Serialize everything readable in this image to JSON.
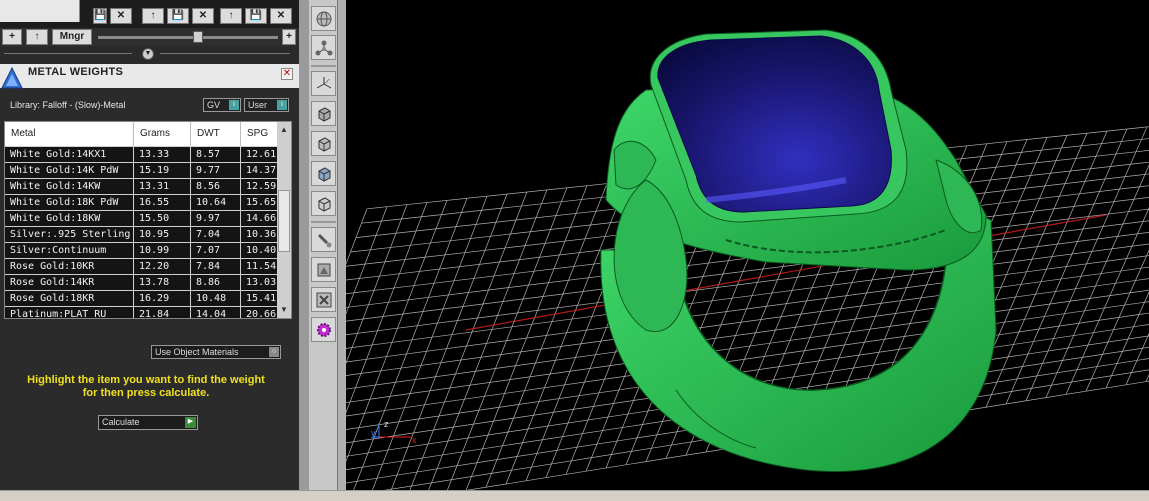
{
  "toolbar_top": {
    "mngr_label": "Mngr",
    "plus_label": "+",
    "up_label": "↑",
    "close_label": "✕",
    "save_label": "💾"
  },
  "panel": {
    "title": "METAL WEIGHTS",
    "close_label": "✕",
    "library_label": "Library: Falloff - (Slow)-Metal",
    "gv_label": "GV",
    "user_label": "User",
    "use_object_materials": "Use Object Materials",
    "hint_line1": "Highlight the item you want to find the weight",
    "hint_line2": "for then press calculate.",
    "calculate_label": "Calculate"
  },
  "table": {
    "headers": [
      "Metal",
      "Grams",
      "DWT",
      "SPG"
    ],
    "rows": [
      [
        "White Gold:14KX1",
        "13.33",
        "8.57",
        "12.61"
      ],
      [
        "White Gold:14K PdW",
        "15.19",
        "9.77",
        "14.37"
      ],
      [
        "White Gold:14KW",
        "13.31",
        "8.56",
        "12.59"
      ],
      [
        "White Gold:18K PdW",
        "16.55",
        "10.64",
        "15.65"
      ],
      [
        "White Gold:18KW",
        "15.50",
        "9.97",
        "14.66"
      ],
      [
        "Silver:.925 Sterling",
        "10.95",
        "7.04",
        "10.36"
      ],
      [
        "Silver:Continuum",
        "10.99",
        "7.07",
        "10.40"
      ],
      [
        "Rose Gold:10KR",
        "12.20",
        "7.84",
        "11.54"
      ],
      [
        "Rose Gold:14KR",
        "13.78",
        "8.86",
        "13.03"
      ],
      [
        "Rose Gold:18KR",
        "16.29",
        "10.48",
        "15.41"
      ],
      [
        "Platinum:PLAT RU",
        "21.84",
        "14.04",
        "20.66"
      ]
    ]
  },
  "viewport": {
    "axis_x": "x",
    "axis_y": "y",
    "axis_z": "z"
  },
  "colors": {
    "ring_green": "#3fd96a",
    "gem_blue": "#1a1670",
    "hint_yellow": "#f0e020",
    "grid_white": "#d0d0d0",
    "axis_red": "#e02020"
  }
}
